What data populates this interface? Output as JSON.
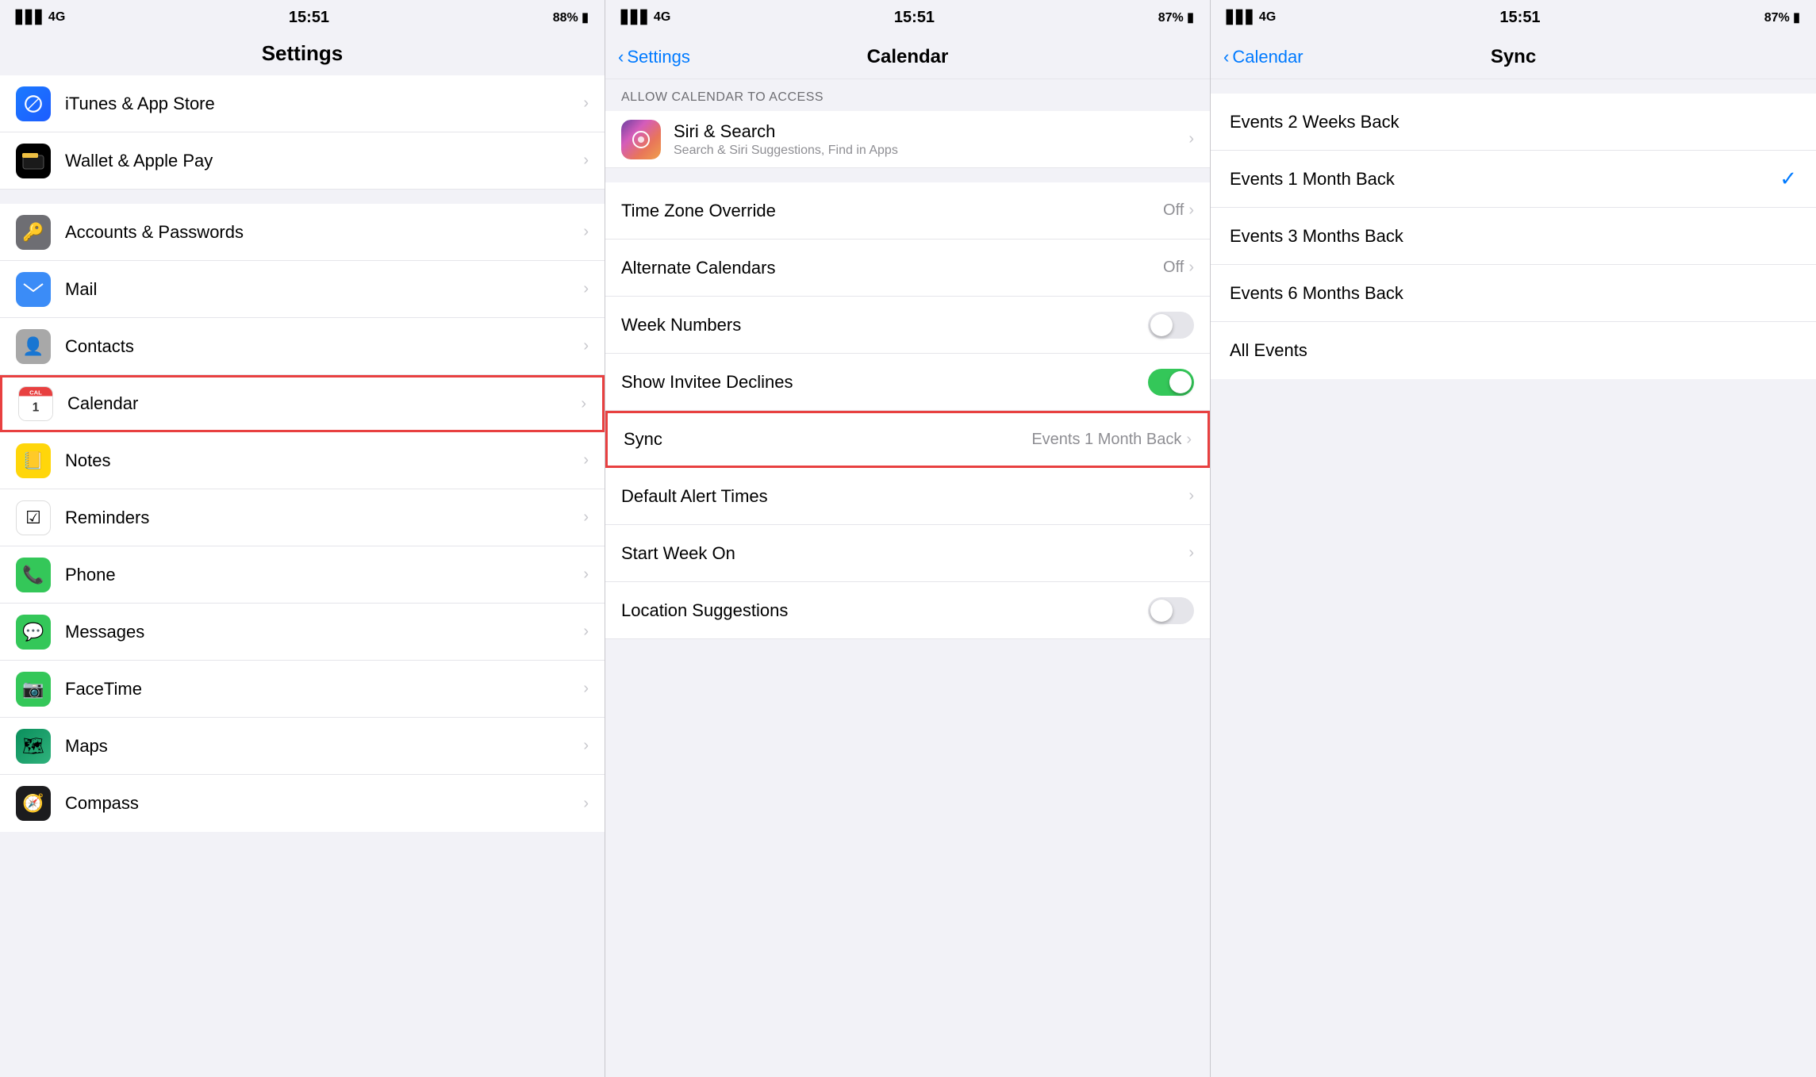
{
  "panels": {
    "left": {
      "status": {
        "signal": "▋▋▋ 4G",
        "time": "15:51",
        "battery": "88% ▮"
      },
      "title": "Settings",
      "rows": [
        {
          "id": "itunes",
          "icon": "🅰",
          "iconClass": "icon-appstore",
          "label": "iTunes & App Store",
          "highlighted": false
        },
        {
          "id": "wallet",
          "icon": "💳",
          "iconClass": "icon-wallet",
          "label": "Wallet & Apple Pay",
          "highlighted": false
        },
        {
          "id": "accounts",
          "icon": "🔑",
          "iconClass": "icon-accounts",
          "label": "Accounts & Passwords",
          "highlighted": false
        },
        {
          "id": "mail",
          "icon": "✉",
          "iconClass": "icon-mail",
          "label": "Mail",
          "highlighted": false
        },
        {
          "id": "contacts",
          "icon": "👤",
          "iconClass": "icon-contacts",
          "label": "Contacts",
          "highlighted": false
        },
        {
          "id": "calendar",
          "icon": "📅",
          "iconClass": "icon-calendar",
          "label": "Calendar",
          "highlighted": true
        },
        {
          "id": "notes",
          "icon": "📒",
          "iconClass": "icon-notes",
          "label": "Notes",
          "highlighted": false
        },
        {
          "id": "reminders",
          "icon": "☑",
          "iconClass": "icon-reminders",
          "label": "Reminders",
          "highlighted": false
        },
        {
          "id": "phone",
          "icon": "📞",
          "iconClass": "icon-phone",
          "label": "Phone",
          "highlighted": false
        },
        {
          "id": "messages",
          "icon": "💬",
          "iconClass": "icon-messages",
          "label": "Messages",
          "highlighted": false
        },
        {
          "id": "facetime",
          "icon": "📷",
          "iconClass": "icon-facetime",
          "label": "FaceTime",
          "highlighted": false
        },
        {
          "id": "maps",
          "icon": "🗺",
          "iconClass": "icon-maps",
          "label": "Maps",
          "highlighted": false
        },
        {
          "id": "compass",
          "icon": "🧭",
          "iconClass": "icon-compass",
          "label": "Compass",
          "highlighted": false
        }
      ]
    },
    "middle": {
      "status": {
        "signal": "▋▋▋ 4G",
        "time": "15:51",
        "battery": "87% ▮"
      },
      "back_label": "Settings",
      "title": "Calendar",
      "section_header": "ALLOW CALENDAR TO ACCESS",
      "siri_row": {
        "label": "Siri & Search",
        "sublabel": "Search & Siri Suggestions, Find in Apps"
      },
      "settings_rows": [
        {
          "id": "timezone",
          "label": "Time Zone Override",
          "value": "Off",
          "type": "chevron"
        },
        {
          "id": "alternate",
          "label": "Alternate Calendars",
          "value": "Off",
          "type": "chevron"
        },
        {
          "id": "weeknumbers",
          "label": "Week Numbers",
          "value": "",
          "type": "toggle",
          "toggled": false
        },
        {
          "id": "invitee",
          "label": "Show Invitee Declines",
          "value": "",
          "type": "toggle",
          "toggled": true
        },
        {
          "id": "sync",
          "label": "Sync",
          "value": "Events 1 Month Back",
          "type": "chevron",
          "highlighted": true
        },
        {
          "id": "alerttimes",
          "label": "Default Alert Times",
          "value": "",
          "type": "chevron"
        },
        {
          "id": "startweek",
          "label": "Start Week On",
          "value": "",
          "type": "chevron"
        },
        {
          "id": "location",
          "label": "Location Suggestions",
          "value": "",
          "type": "toggle",
          "toggled": false
        }
      ]
    },
    "right": {
      "status": {
        "signal": "▋▋▋ 4G",
        "time": "15:51",
        "battery": "87% ▮"
      },
      "back_label": "Calendar",
      "title": "Sync",
      "options": [
        {
          "id": "2weeks",
          "label": "Events 2 Weeks Back",
          "selected": false
        },
        {
          "id": "1month",
          "label": "Events 1 Month Back",
          "selected": true
        },
        {
          "id": "3months",
          "label": "Events 3 Months Back",
          "selected": false
        },
        {
          "id": "6months",
          "label": "Events 6 Months Back",
          "selected": false
        },
        {
          "id": "all",
          "label": "All Events",
          "selected": false
        }
      ]
    }
  }
}
